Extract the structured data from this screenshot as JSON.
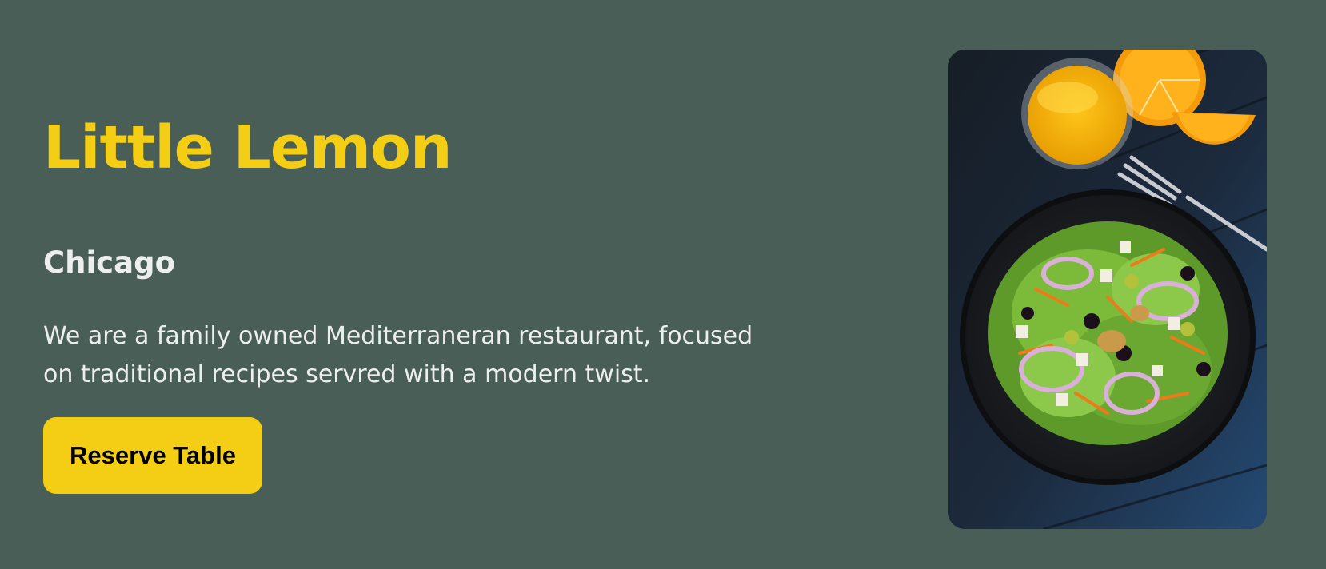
{
  "hero": {
    "title": "Little Lemon",
    "subtitle": "Chicago",
    "description": "We are a family owned Mediterraneran restaurant, focused on traditional recipes servred with a modern twist.",
    "reserve_label": "Reserve Table",
    "image_icon": "salad-photo-icon"
  },
  "colors": {
    "background": "#495e57",
    "accent": "#f4ce14",
    "text_light": "#edefee",
    "button_text": "#000000"
  }
}
